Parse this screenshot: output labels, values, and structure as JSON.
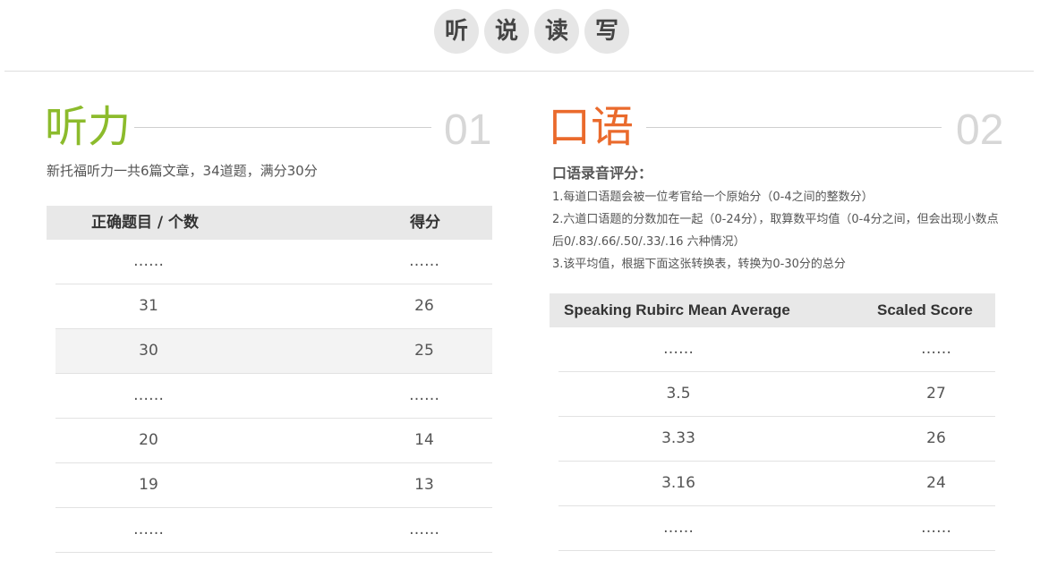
{
  "tabs": [
    "听",
    "说",
    "读",
    "写"
  ],
  "listening": {
    "title": "听力",
    "number": "01",
    "description": "新托福听力一共6篇文章，34道题，满分30分",
    "header": [
      "正确题目 / 个数",
      "得分"
    ],
    "rows": [
      [
        "……",
        "……"
      ],
      [
        "31",
        "26"
      ],
      [
        "30",
        "25"
      ],
      [
        "……",
        "……"
      ],
      [
        "20",
        "14"
      ],
      [
        "19",
        "13"
      ],
      [
        "……",
        "……"
      ]
    ]
  },
  "speaking": {
    "title": "口语",
    "number": "02",
    "subtitle": "口语录音评分：",
    "lines": [
      "1.每道口语题会被一位考官给一个原始分（0-4之间的整数分）",
      "2.六道口语题的分数加在一起（0-24分），取算数平均值（0-4分之间，但会出现小数点后0/.83/.66/.50/.33/.16 六种情况）",
      "3.该平均值，根据下面这张转换表，转换为0-30分的总分"
    ],
    "header": [
      "Speaking Rubirc Mean Average",
      "Scaled Score"
    ],
    "rows": [
      [
        "……",
        "……"
      ],
      [
        "3.5",
        "27"
      ],
      [
        "3.33",
        "26"
      ],
      [
        "3.16",
        "24"
      ],
      [
        "……",
        "……"
      ]
    ]
  }
}
